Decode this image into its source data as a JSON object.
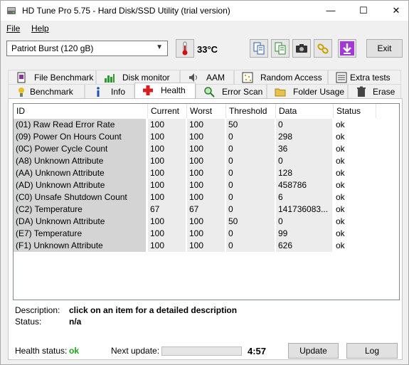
{
  "window": {
    "title": "HD Tune Pro 5.75 - Hard Disk/SSD Utility (trial version)",
    "controls": {
      "minimize": "—",
      "maximize": "☐",
      "close": "✕"
    }
  },
  "menu": [
    {
      "label": "File"
    },
    {
      "label": "Help"
    }
  ],
  "toolbar": {
    "drive": "Patriot Burst (120 gB)",
    "temperature": "33°C",
    "exit_label": "Exit"
  },
  "tabs_row1": [
    {
      "label": "File Benchmark",
      "icon": "file-benchmark-icon"
    },
    {
      "label": "Disk monitor",
      "icon": "disk-monitor-icon"
    },
    {
      "label": "AAM",
      "icon": "speaker-icon"
    },
    {
      "label": "Random Access",
      "icon": "random-access-icon"
    },
    {
      "label": "Extra tests",
      "icon": "extra-tests-icon"
    }
  ],
  "tabs_row2": [
    {
      "label": "Benchmark",
      "icon": "benchmark-icon"
    },
    {
      "label": "Info",
      "icon": "info-icon"
    },
    {
      "label": "Health",
      "icon": "health-cross-icon",
      "active": true
    },
    {
      "label": "Error Scan",
      "icon": "magnifier-icon"
    },
    {
      "label": "Folder Usage",
      "icon": "folder-icon"
    },
    {
      "label": "Erase",
      "icon": "trash-icon"
    }
  ],
  "table": {
    "headers": [
      "ID",
      "Current",
      "Worst",
      "Threshold",
      "Data",
      "Status"
    ],
    "rows": [
      [
        "(01) Raw Read Error Rate",
        "100",
        "100",
        "50",
        "0",
        "ok"
      ],
      [
        "(09) Power On Hours Count",
        "100",
        "100",
        "0",
        "298",
        "ok"
      ],
      [
        "(0C) Power Cycle Count",
        "100",
        "100",
        "0",
        "36",
        "ok"
      ],
      [
        "(A8) Unknown Attribute",
        "100",
        "100",
        "0",
        "0",
        "ok"
      ],
      [
        "(AA) Unknown Attribute",
        "100",
        "100",
        "0",
        "128",
        "ok"
      ],
      [
        "(AD) Unknown Attribute",
        "100",
        "100",
        "0",
        "458786",
        "ok"
      ],
      [
        "(C0) Unsafe Shutdown Count",
        "100",
        "100",
        "0",
        "6",
        "ok"
      ],
      [
        "(C2) Temperature",
        "67",
        "67",
        "0",
        "141736083...",
        "ok"
      ],
      [
        "(DA) Unknown Attribute",
        "100",
        "100",
        "50",
        "0",
        "ok"
      ],
      [
        "(E7) Temperature",
        "100",
        "100",
        "0",
        "99",
        "ok"
      ],
      [
        "(F1) Unknown Attribute",
        "100",
        "100",
        "0",
        "626",
        "ok"
      ]
    ]
  },
  "description": {
    "desc_label": "Description:",
    "desc_value": "click on an item for a detailed description",
    "status_label": "Status:",
    "status_value": "n/a"
  },
  "footer": {
    "health_label": "Health status:",
    "health_value": "ok",
    "health_color": "#17a817",
    "next_update_label": "Next update:",
    "progress_fraction": 0.0,
    "countdown": "4:57",
    "update_label": "Update",
    "log_label": "Log"
  }
}
